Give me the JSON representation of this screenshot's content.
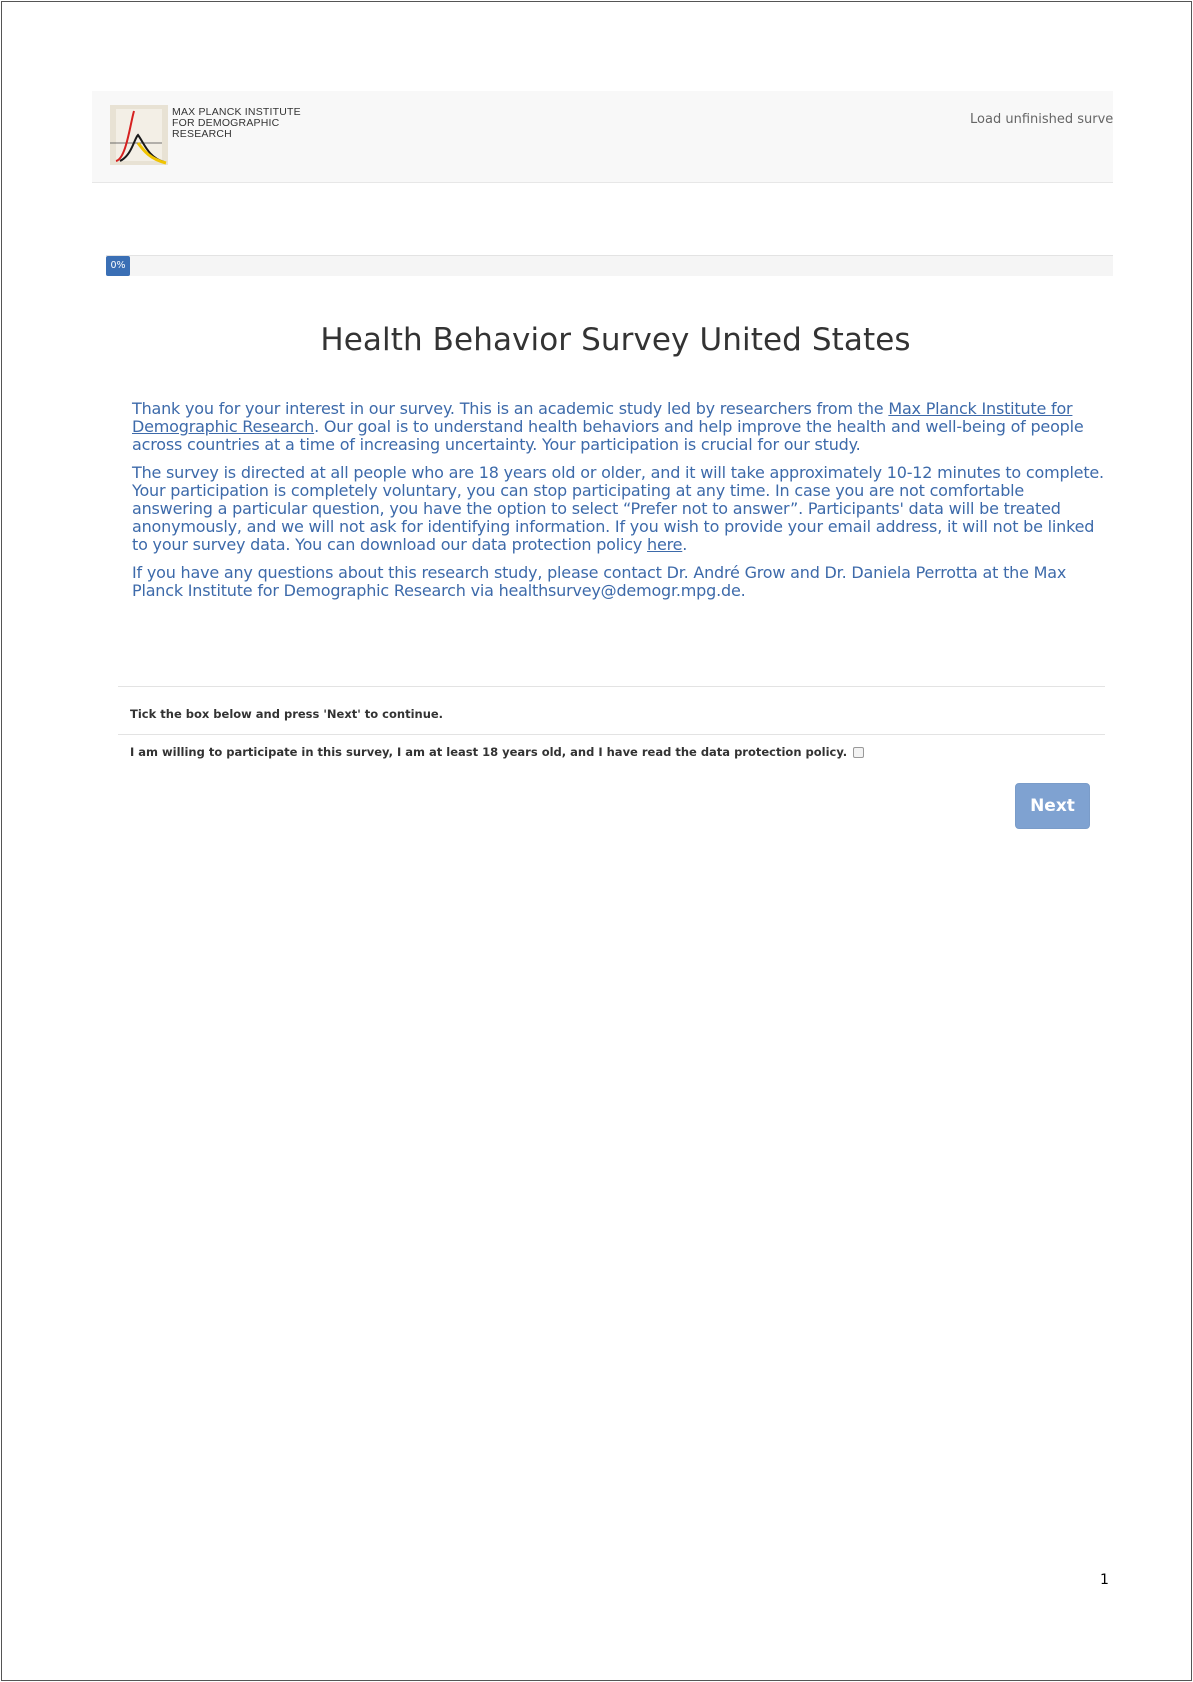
{
  "header": {
    "logo_lines": [
      "MAX PLANCK INSTITUTE",
      "FOR DEMOGRAPHIC",
      "RESEARCH"
    ],
    "load_link": "Load unfinished survey",
    "colors": {
      "red": "#d6201f",
      "yellow": "#f0c400",
      "black": "#1a1a1a"
    }
  },
  "progress": {
    "label": "0%",
    "value": 0
  },
  "survey": {
    "title": "Health Behavior Survey United States",
    "p1": {
      "before": "Thank you for your interest in our survey. This is an academic study led by researchers from the ",
      "link": "Max Planck Institute for Demographic Research",
      "after": ". Our goal is to understand health behaviors and help improve the health and well-being of people across countries at a time of increasing uncertainty. Your participation is crucial for our study."
    },
    "p2": {
      "before": "The survey is directed at all people who are 18 years old or older, and it will take approximately 10-12 minutes to complete. Your participation is completely voluntary, you can stop participating at any time. In case you are not comfortable answering a particular question, you have the option to select “Prefer not to answer”. Participants' data will be treated anonymously, and we will not ask for identifying information. If you wish to provide your email address, it will not be linked to your survey data. You can download our data protection policy ",
      "link": "here",
      "after": "."
    },
    "p3": "If you have any questions about this research study, please contact Dr. André Grow and Dr. Daniela Perrotta at the Max Planck Institute for Demographic Research via healthsurvey@demogr.mpg.de."
  },
  "form": {
    "instruction": "Tick the box below and press 'Next' to continue.",
    "consent_label": "I am willing to participate in this survey, I am at least 18 years old, and I have read the data protection policy.",
    "consent_checked": false,
    "next_label": "Next"
  },
  "page_number": "1"
}
